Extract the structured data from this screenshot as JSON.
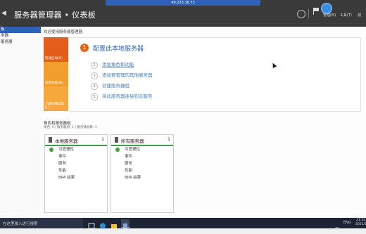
{
  "window": {
    "connection_address": "49.233.38.73",
    "title": "服务器管理器 • 仪表板",
    "menus": [
      "管理(M)",
      "工具(T)",
      "视"
    ]
  },
  "sidebar": {
    "items": [
      {
        "label": "板",
        "selected": true
      },
      {
        "label": "务器",
        "selected": false
      },
      {
        "label": "服务器",
        "selected": false
      }
    ]
  },
  "welcome_title": "欢迎使用服务器管理器",
  "tiles": [
    "快速启动(Q)",
    "新增功能(W)",
    "了解详细信息(L)"
  ],
  "configure": {
    "main_number": "1",
    "main_label": "配置此本地服务器",
    "steps": [
      {
        "num": "2",
        "label": "添加角色和功能"
      },
      {
        "num": "3",
        "label": "添加要管理的其他服务器"
      },
      {
        "num": "4",
        "label": "创建服务器组"
      },
      {
        "num": "5",
        "label": "将此服务器连接到云服务"
      }
    ]
  },
  "roles": {
    "title": "角色和服务器组",
    "subtitle": "角色: 0 | 服务器组: 1 | 服务器总数: 1",
    "cards": [
      {
        "title": "本地服务器",
        "count": "1",
        "rows": [
          "可管理性",
          "事件",
          "服务",
          "性能",
          "BPA 结果"
        ]
      },
      {
        "title": "所有服务器",
        "count": "1",
        "rows": [
          "可管理性",
          "事件",
          "服务",
          "性能",
          "BPA 结果"
        ]
      }
    ]
  },
  "taskbar": {
    "search_placeholder": "在这里输入进行搜索",
    "language": "ENG",
    "time": "21:52",
    "date": "2022/1..."
  },
  "colors": {
    "titlebar": "#3a3a3a",
    "accent_blue": "#2a62b9",
    "tile_orange": "#e45e1a",
    "status_green": "#3ca43c"
  }
}
